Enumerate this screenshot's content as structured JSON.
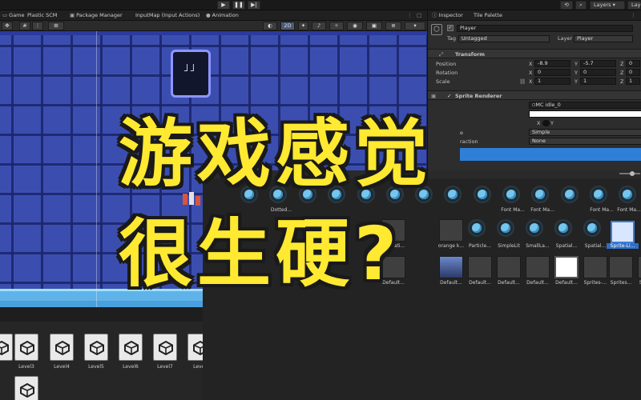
{
  "toolbar": {
    "play": "▶",
    "pause": "❚❚",
    "step": "▶|",
    "layers": "Layers",
    "layout": "Layers"
  },
  "tabs": [
    {
      "label": "Game",
      "icon": "game-icon"
    },
    {
      "label": "Plastic SCM",
      "icon": "plastic-icon"
    },
    {
      "label": "Package Manager",
      "icon": "package-icon"
    },
    {
      "label": "InputMap (Input Actions)",
      "icon": "input-icon"
    },
    {
      "label": "Animation",
      "icon": "animation-icon"
    }
  ],
  "scene_toolbar": {
    "mode_2d": "2D"
  },
  "overlay": {
    "line1": "游戏感觉",
    "line2": "很生硬?"
  },
  "inspector": {
    "tabs": [
      "Inspector",
      "Tile Palette"
    ],
    "object_name": "Player",
    "tag_label": "Tag",
    "tag_value": "Untagged",
    "layer_label": "Layer",
    "layer_value": "Player",
    "transform_title": "Transform",
    "position_label": "Position",
    "position": {
      "x": "-8.9",
      "y": "-5.7",
      "z": "0"
    },
    "rotation_label": "Rotation",
    "rotation": {
      "x": "0",
      "y": "0",
      "z": "0"
    },
    "scale_label": "Scale",
    "scale": {
      "x": "1",
      "y": "1",
      "z": "1"
    },
    "sprite_renderer_title": "Sprite Renderer",
    "sprite_value": "MC idle_0",
    "flip_x": "X",
    "flip_y": "Y",
    "draw_mode_label": "e",
    "draw_mode_value": "Simple",
    "interaction_label": "raction",
    "interaction_value": "None",
    "axis_x": "X",
    "axis_y": "Y",
    "axis_z": "Z"
  },
  "bottom_assets": [
    {
      "label": "Level3"
    },
    {
      "label": "Level4"
    },
    {
      "label": "Level5"
    },
    {
      "label": "Level6"
    },
    {
      "label": "Level7"
    },
    {
      "label": "Level"
    }
  ],
  "project_items_row1": [
    {
      "label": "Dotted..."
    },
    {
      "label": ""
    },
    {
      "label": ""
    },
    {
      "label": ""
    },
    {
      "label": ""
    },
    {
      "label": ""
    },
    {
      "label": "Font Ma..."
    },
    {
      "label": "Font Ma..."
    },
    {
      "label": "Font Ma..."
    },
    {
      "label": "Font Ma..."
    }
  ],
  "project_items_row2": [
    {
      "label": "Liberati..."
    },
    {
      "label": "orange k..."
    },
    {
      "label": "Particle..."
    },
    {
      "label": "SimpleLit"
    },
    {
      "label": "SmallLa..."
    },
    {
      "label": "Spatial..."
    },
    {
      "label": "Spatial..."
    },
    {
      "label": "Sprite-Li..."
    }
  ],
  "project_items_row3": [
    {
      "label": "Default..."
    },
    {
      "label": "Default..."
    },
    {
      "label": "Default..."
    },
    {
      "label": "Default..."
    },
    {
      "label": "Default..."
    },
    {
      "label": "Default..."
    },
    {
      "label": "Sprites-..."
    },
    {
      "label": "Sprites..."
    },
    {
      "label": "Spatial..."
    }
  ]
}
